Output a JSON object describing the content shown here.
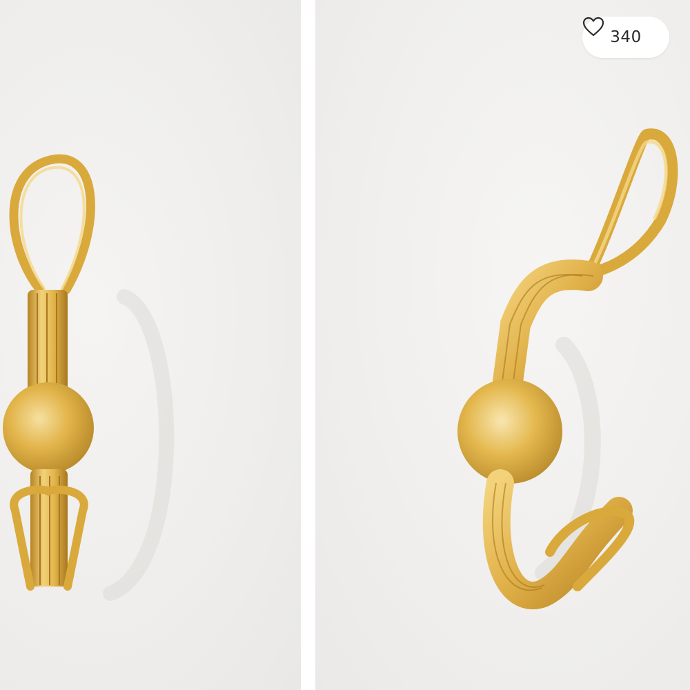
{
  "gallery": {
    "images": [
      {
        "icon": "gold-wire-hook-front-view"
      },
      {
        "icon": "gold-wire-hook-side-view"
      }
    ],
    "like_button": {
      "count": "340",
      "icon": "heart-outline-icon"
    }
  },
  "colors": {
    "gold_light": "#f2d27a",
    "gold_mid": "#e2b44a",
    "gold_dark": "#b78424",
    "background": "#f0efed",
    "text": "#2a2a2a"
  }
}
